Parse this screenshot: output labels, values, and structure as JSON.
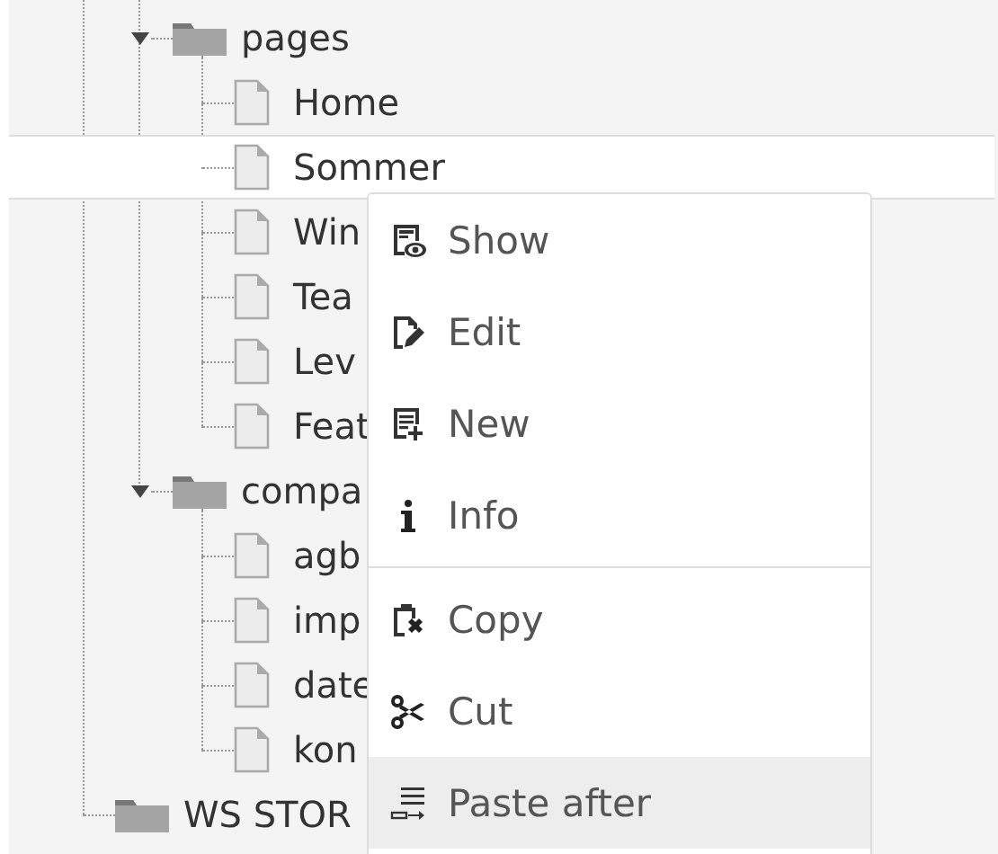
{
  "tree": [
    {
      "children": [
        {
          "label": "pages",
          "kind": "folder",
          "expanded": true,
          "selected": false,
          "children": [
            {
              "label": "Home",
              "kind": "page",
              "selected": false
            },
            {
              "label": "Sommer",
              "kind": "page",
              "selected": true
            },
            {
              "label": "Win",
              "kind": "page",
              "selected": false
            },
            {
              "label": "Tea",
              "kind": "page",
              "selected": false
            },
            {
              "label": "Lev",
              "kind": "page",
              "selected": false
            },
            {
              "label": "Feat",
              "kind": "page",
              "selected": false
            }
          ]
        },
        {
          "label": "compa",
          "kind": "folder",
          "expanded": true,
          "selected": false,
          "children": [
            {
              "label": "agb",
              "kind": "page",
              "selected": false
            },
            {
              "label": "imp",
              "kind": "page",
              "selected": false
            },
            {
              "label": "date",
              "kind": "page",
              "selected": false
            },
            {
              "label": "kon",
              "kind": "page",
              "selected": false
            }
          ]
        }
      ]
    },
    {
      "label": "WS STOR",
      "kind": "folder",
      "selected": false
    }
  ],
  "context_menu": {
    "groups": [
      [
        {
          "label": "Show",
          "kind": "show",
          "selected": false
        },
        {
          "label": "Edit",
          "kind": "edit",
          "selected": false
        },
        {
          "label": "New",
          "kind": "new",
          "selected": false
        },
        {
          "label": "Info",
          "kind": "info",
          "selected": false
        }
      ],
      [
        {
          "label": "Copy",
          "kind": "copy",
          "selected": false
        },
        {
          "label": "Cut",
          "kind": "cut",
          "selected": false
        },
        {
          "label": "Paste after",
          "kind": "paste",
          "selected": true
        }
      ]
    ]
  }
}
